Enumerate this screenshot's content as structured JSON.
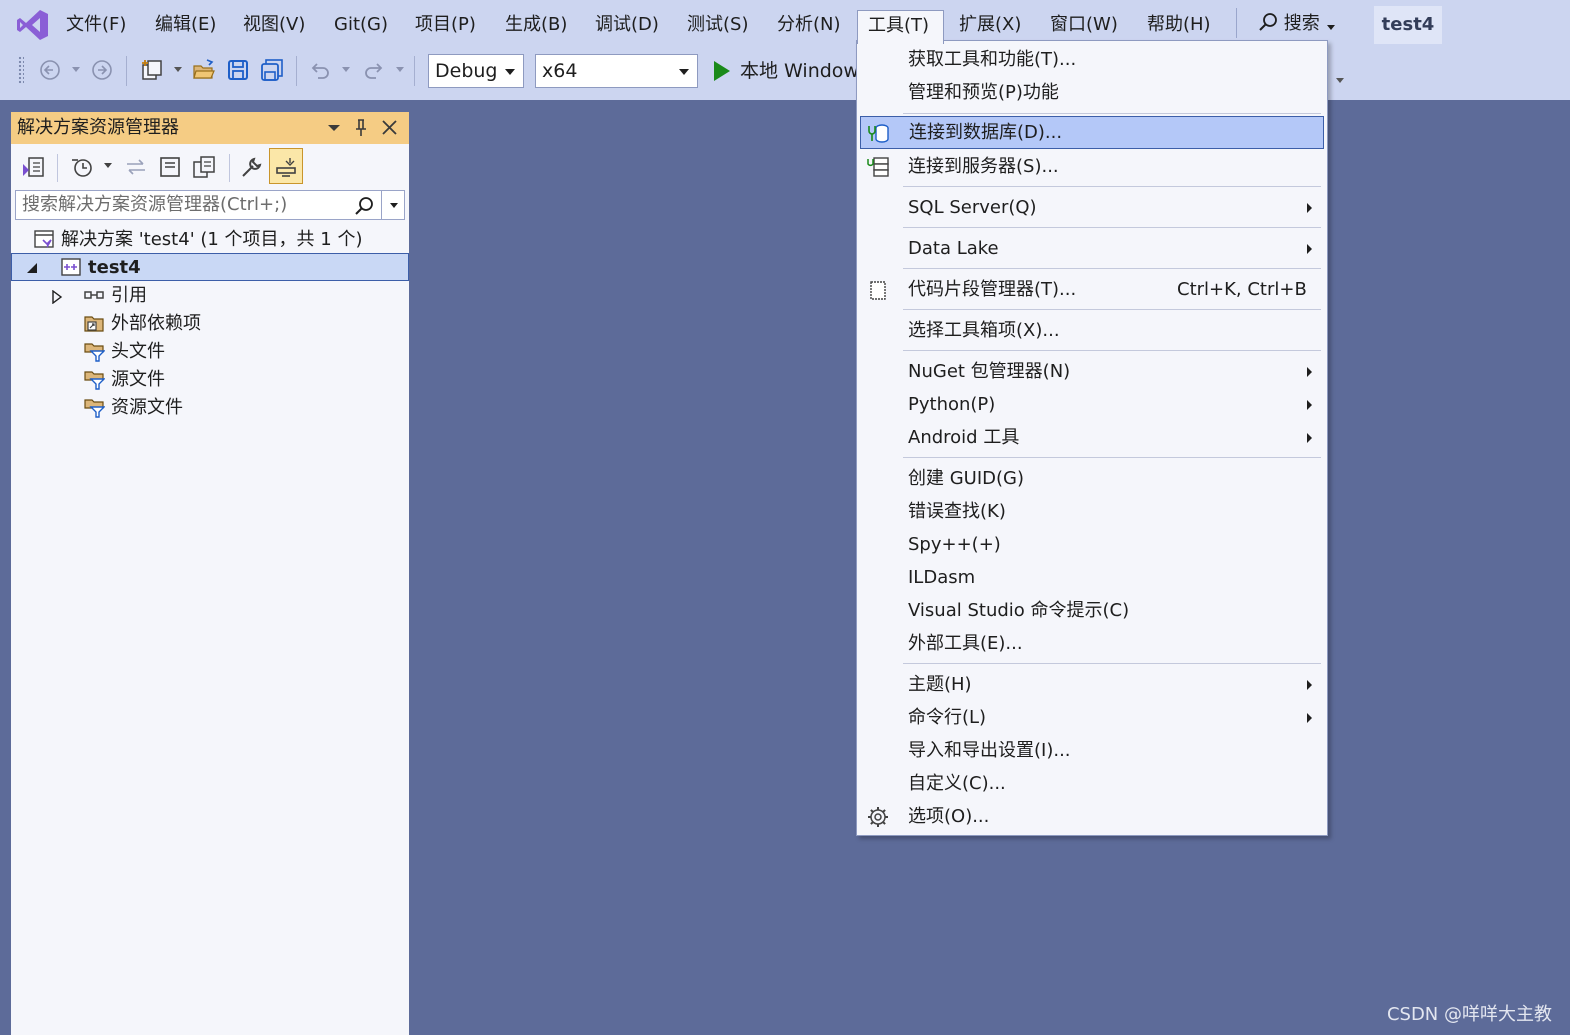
{
  "menubar": {
    "items": [
      "文件(F)",
      "编辑(E)",
      "视图(V)",
      "Git(G)",
      "项目(P)",
      "生成(B)",
      "调试(D)",
      "测试(S)",
      "分析(N)",
      "工具(T)",
      "扩展(X)",
      "窗口(W)",
      "帮助(H)"
    ],
    "open_item": "工具(T)",
    "search_label": "搜索",
    "project_name": "test4"
  },
  "toolbar": {
    "configuration": "Debug",
    "platform": "x64",
    "run_label": "本地 Windows"
  },
  "solution_explorer": {
    "title": "解决方案资源管理器",
    "search_placeholder": "搜索解决方案资源管理器(Ctrl+;)",
    "tree": {
      "solution": "解决方案 'test4' (1 个项目，共 1 个)",
      "project": "test4",
      "children": [
        "引用",
        "外部依赖项",
        "头文件",
        "源文件",
        "资源文件"
      ]
    }
  },
  "tools_menu": {
    "items": [
      {
        "label": "获取工具和功能(T)..."
      },
      {
        "label": "管理和预览(P)功能"
      },
      {
        "label": "连接到数据库(D)...",
        "icon": "database-connect-icon",
        "highlighted": true
      },
      {
        "label": "连接到服务器(S)...",
        "icon": "server-connect-icon"
      },
      {
        "label": "SQL Server(Q)",
        "submenu": true
      },
      {
        "label": "Data Lake",
        "submenu": true
      },
      {
        "label": "代码片段管理器(T)...",
        "shortcut": "Ctrl+K, Ctrl+B",
        "icon": "snippet-icon"
      },
      {
        "label": "选择工具箱项(X)..."
      },
      {
        "label": "NuGet 包管理器(N)",
        "submenu": true
      },
      {
        "label": "Python(P)",
        "submenu": true
      },
      {
        "label": "Android 工具",
        "submenu": true
      },
      {
        "label": "创建 GUID(G)"
      },
      {
        "label": "错误查找(K)"
      },
      {
        "label": "Spy++(+)"
      },
      {
        "label": "ILDasm"
      },
      {
        "label": "Visual Studio 命令提示(C)"
      },
      {
        "label": "外部工具(E)..."
      },
      {
        "label": "主题(H)",
        "submenu": true
      },
      {
        "label": "命令行(L)",
        "submenu": true
      },
      {
        "label": "导入和导出设置(I)..."
      },
      {
        "label": "自定义(C)..."
      },
      {
        "label": "选项(O)...",
        "icon": "gear-icon"
      }
    ]
  },
  "watermark": "CSDN @咩咩大主教",
  "colors": {
    "background": "#5d6b99",
    "chrome": "#ccd5f0",
    "panel_header": "#f5cc84",
    "highlight": "#b4c8f8"
  }
}
